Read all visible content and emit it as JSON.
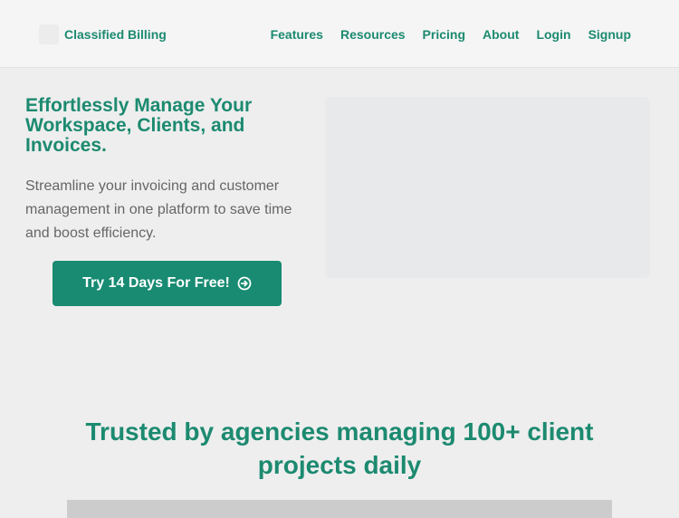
{
  "brand": {
    "name": "Classified Billing"
  },
  "nav": {
    "items": [
      "Features",
      "Resources",
      "Pricing",
      "About",
      "Login",
      "Signup"
    ]
  },
  "hero": {
    "title": "Effortlessly Manage Your Workspace, Clients, and Invoices.",
    "subtitle": "Streamline your invoicing and customer management in one platform to save time and boost efficiency.",
    "cta_label": "Try 14 Days For Free!",
    "cta_icon": "arrow-circle-right-icon"
  },
  "trusted": {
    "heading": "Trusted by agencies managing 100+ client projects daily"
  },
  "colors": {
    "accent": "#1c8a70",
    "button": "#188b72",
    "background": "#eeeeee",
    "navbar": "#f5f5f5",
    "body_text": "#666666"
  }
}
